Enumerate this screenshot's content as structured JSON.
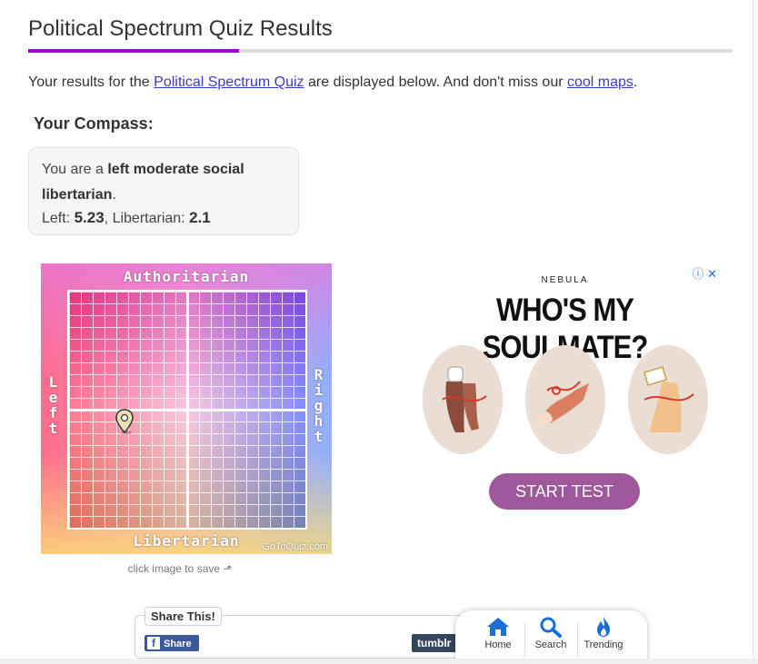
{
  "header": {
    "title": "Political Spectrum Quiz Results",
    "accent_color": "#9a00d0"
  },
  "intro": {
    "prefix": "Your results for the ",
    "quiz_link": "Political Spectrum Quiz",
    "middle": " are displayed below. And don't miss our ",
    "maps_link": "cool maps",
    "suffix": "."
  },
  "compass_section": {
    "heading": "Your Compass:",
    "you_are": "You are a ",
    "result_label": "left moderate social libertarian",
    "result_period": ".",
    "left_label": "Left: ",
    "left_value": "5.23",
    "separator": ", ",
    "lib_label": "Libertarian: ",
    "lib_value": "2.1"
  },
  "compass_image": {
    "top_label": "Authoritarian",
    "bottom_label": "Libertarian",
    "left_label": "Left",
    "right_label": "Right",
    "watermark": "GoToQuiz.com",
    "caption": "click image to save ⬏"
  },
  "ad": {
    "brand": "NEBULA",
    "headline": "WHO'S MY SOULMATE?",
    "cta": "START TEST",
    "controls": "ⓘ ✕",
    "cta_color": "#a0589c"
  },
  "share": {
    "label": "Share This!",
    "facebook_icon": "f",
    "facebook_label": "Share",
    "tumblr_label": "tumblr"
  },
  "bottom_nav": {
    "items": [
      {
        "label": "Home",
        "icon": "home-icon"
      },
      {
        "label": "Search",
        "icon": "search-icon"
      },
      {
        "label": "Trending",
        "icon": "flame-icon"
      }
    ],
    "icon_color": "#1a6fd6"
  }
}
